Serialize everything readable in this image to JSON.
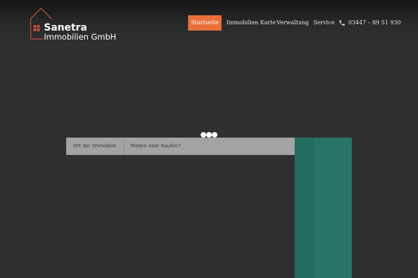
{
  "brand": {
    "line1": "Sanetra",
    "line2": "Immobilien GmbH",
    "accent_color": "#c2523d"
  },
  "nav": {
    "items": [
      {
        "label": "Startseite",
        "active": true
      },
      {
        "label": "Immobilien Karte",
        "active": false
      },
      {
        "label": "Verwaltung",
        "active": false
      },
      {
        "label": "Service",
        "active": false
      }
    ],
    "phone": "03447 – 89 51 930",
    "active_color": "#e9703a"
  },
  "search": {
    "location_label": "Ort der Immobilie",
    "type_label": "Mieten oder Kaufen?"
  },
  "icons": [
    "house-logo-icon",
    "phone-icon",
    "loading-dots-icon"
  ],
  "colors": {
    "background": "#303030",
    "search_bar": "#a3a3a4",
    "teal_panel": "#287468"
  }
}
